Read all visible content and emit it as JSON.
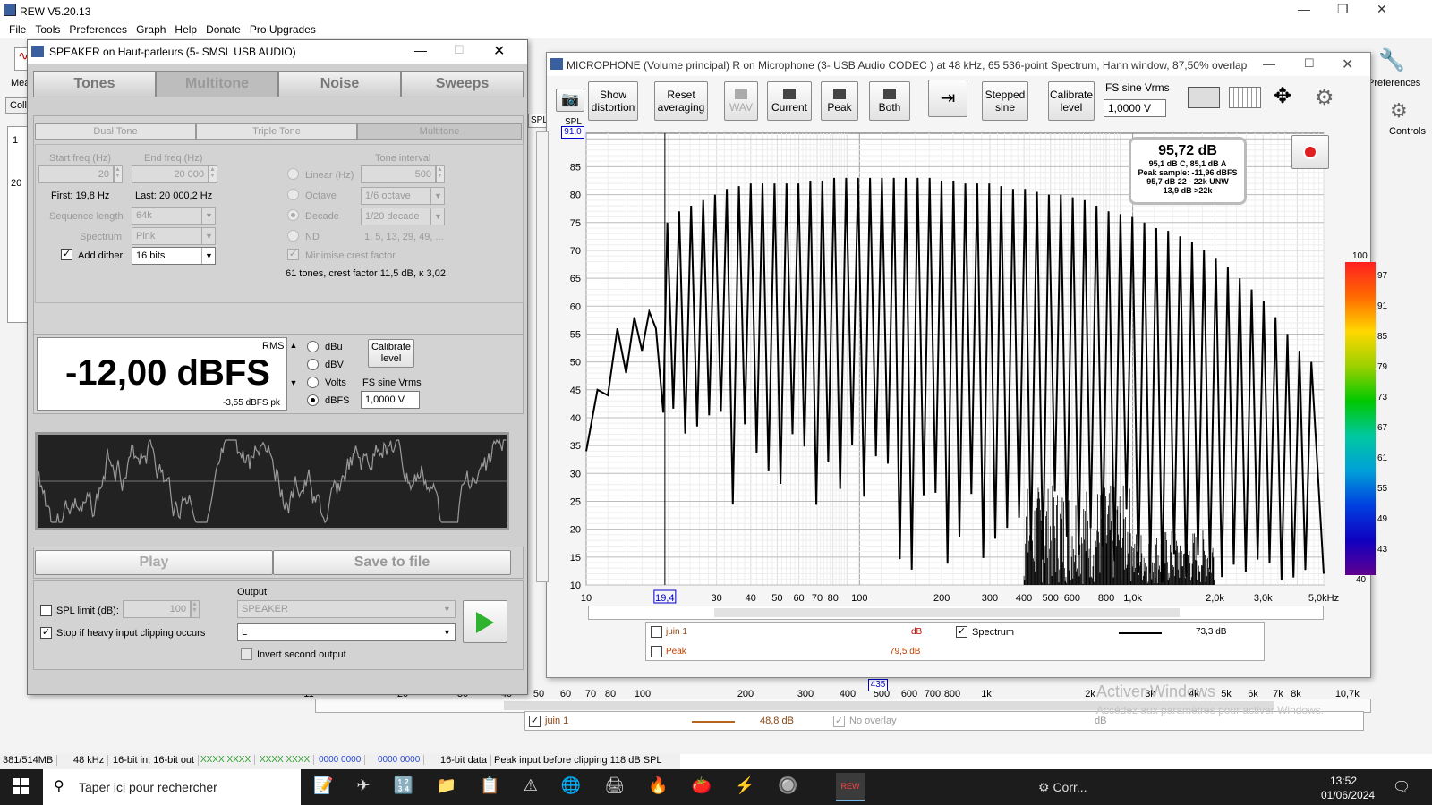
{
  "app": {
    "title": "REW V5.20.13",
    "menu": [
      "File",
      "Tools",
      "Preferences",
      "Graph",
      "Help",
      "Donate",
      "Pro Upgrades"
    ],
    "right_tools": {
      "preferences": "Preferences",
      "controls": "Controls"
    }
  },
  "bg": {
    "mea": "Mea",
    "colla": "Colla",
    "n1": "1",
    "n20": "20",
    "spl": "SPL",
    "xaxis": [
      "11",
      "20",
      "30",
      "40",
      "50",
      "60",
      "70",
      "80",
      "100",
      "200",
      "300",
      "400",
      "500",
      "600",
      "700",
      "800",
      "1k",
      "2k",
      "3k",
      "4k",
      "5k",
      "6k",
      "7k",
      "8k",
      "10,7kHz"
    ],
    "cursor": "435",
    "legend": {
      "name": "juin 1",
      "value": "48,8 dB",
      "overlay": "No overlay",
      "unit": "dB"
    },
    "watermark1": "Activer Windows",
    "watermark2": "Accédez aux paramètres pour activer Windows."
  },
  "status": [
    "381/514MB",
    "48 kHz",
    "16-bit in, 16-bit out",
    "XXXX XXXX",
    "XXXX XXXX",
    "0000 0000",
    "0000 0000",
    "16-bit data",
    "Peak input before clipping 118 dB SPL"
  ],
  "speaker": {
    "title": "SPEAKER on Haut-parleurs (5- SMSL USB AUDIO)",
    "tabs": [
      "Tones",
      "Multitone",
      "Noise",
      "Sweeps"
    ],
    "subtabs": [
      "Dual Tone",
      "Triple Tone",
      "Multitone"
    ],
    "start_label": "Start freq (Hz)",
    "start_val": "20",
    "end_label": "End freq (Hz)",
    "end_val": "20 000",
    "first": "First: 19,8 Hz",
    "last": "Last: 20 000,2 Hz",
    "seq_label": "Sequence length",
    "seq_val": "64k",
    "spectrum_label": "Spectrum",
    "spectrum_val": "Pink",
    "dither_label": "Add dither",
    "dither_val": "16 bits",
    "tone_interval_label": "Tone interval",
    "tone_interval_val": "500",
    "linear": "Linear (Hz)",
    "octave": "Octave",
    "octave_val": "1/6 octave",
    "decade": "Decade",
    "decade_val": "1/20 decade",
    "nd": "ND",
    "nd_val": "1, 5, 13, 29, 49, ...",
    "minimise": "Minimise crest factor",
    "tones_info": "61 tones, crest factor 11,5 dB, κ 3,02",
    "rms": "RMS",
    "level": "-12,00 dBFS",
    "peak": "-3,55 dBFS pk",
    "units": [
      "dBu",
      "dBV",
      "Volts",
      "dBFS"
    ],
    "calibrate": "Calibrate level",
    "fs_label": "FS sine Vrms",
    "fs_val": "1,0000 V",
    "play": "Play",
    "save": "Save to file",
    "spl_limit": "SPL limit (dB):",
    "spl_limit_val": "100",
    "stop_clip": "Stop if heavy input clipping occurs",
    "output_label": "Output",
    "output_val": "SPEAKER",
    "channel_val": "L",
    "invert": "Invert second output"
  },
  "mic": {
    "title": "MICROPHONE (Volume principal) R on Microphone (3- USB Audio CODEC ) at 48 kHz, 65 536-point Spectrum, Hann window, 87,50% overlap...",
    "buttons": {
      "show_distortion": "Show distortion",
      "reset": "Reset averaging",
      "wav": "WAV",
      "current": "Current",
      "peak": "Peak",
      "both": "Both",
      "stepped": "Stepped sine",
      "calibrate": "Calibrate level"
    },
    "fs_label": "FS sine Vrms",
    "fs_val": "1,0000 V",
    "spl_label": "SPL",
    "spl_val": "91,0",
    "readout": {
      "main": "95,72 dB",
      "l1": "95,1 dB C, 85,1 dB A",
      "l2": "Peak sample: -11,96 dBFS",
      "l3": "95,7 dB 22 - 22k UNW",
      "l4": "13,9 dB >22k"
    },
    "colorbar": [
      "100",
      "97",
      "91",
      "85",
      "79",
      "73",
      "67",
      "61",
      "55",
      "49",
      "43",
      "40"
    ],
    "legend": {
      "r1name": "juin 1",
      "r1unit": "dB",
      "r1series": "Spectrum",
      "r1val": "73,3 dB",
      "r2name": "Peak",
      "r2val": "79,5 dB"
    }
  },
  "chart_data": {
    "type": "line",
    "xscale": "log",
    "xlim": [
      10,
      5000
    ],
    "ylim": [
      10,
      91
    ],
    "xlabel": "",
    "ylabel": "SPL",
    "xticks": [
      "10",
      "19,4",
      "30",
      "40",
      "50",
      "60",
      "70",
      "80",
      "100",
      "200",
      "300",
      "400",
      "500",
      "600",
      "800",
      "1,0k",
      "2,0k",
      "3,0k",
      "5,0kHz"
    ],
    "yticks": [
      "85",
      "80",
      "75",
      "70",
      "65",
      "60",
      "55",
      "50",
      "45",
      "40",
      "35",
      "30",
      "25",
      "20",
      "15",
      "10"
    ],
    "cursor_x": "19,4",
    "series": [
      {
        "name": "Spectrum",
        "tone_freqs": [
          19.8,
          21.9,
          24.2,
          26.8,
          29.6,
          32.7,
          36.2,
          40.0,
          44.2,
          48.9,
          54.1,
          59.8,
          66.1,
          73.1,
          80.8,
          89.4,
          98.8,
          109.3,
          120.8,
          133.6,
          147.7,
          163.3,
          180.6,
          199.7,
          220.8,
          244.1,
          269.9,
          298.5,
          330.0,
          364.9,
          403.5,
          446.2,
          493.4,
          545.6,
          603.3,
          667.1,
          737.6,
          815.6,
          901.8,
          997.2,
          1102.7,
          1219.3,
          1348.3,
          1490.9,
          1648.5,
          1822.9,
          2015.7,
          2228.9,
          2464.6,
          2725.3,
          3013.5,
          3332.2,
          3684.7,
          4074.3,
          4505.3
        ],
        "peak_db": [
          75,
          77,
          78,
          79,
          80,
          81,
          81.5,
          82,
          82,
          82,
          82,
          82,
          82.5,
          82.5,
          83,
          83,
          83,
          83,
          83,
          83,
          83,
          83,
          83,
          82.5,
          82.5,
          82,
          82,
          82,
          81.5,
          81,
          81,
          80.5,
          80,
          80,
          79.5,
          79,
          78,
          77,
          76.5,
          76,
          75,
          74,
          73.5,
          72.5,
          71.5,
          70,
          68.5,
          67,
          65,
          63,
          61,
          58,
          55,
          52,
          50
        ]
      }
    ]
  }
}
